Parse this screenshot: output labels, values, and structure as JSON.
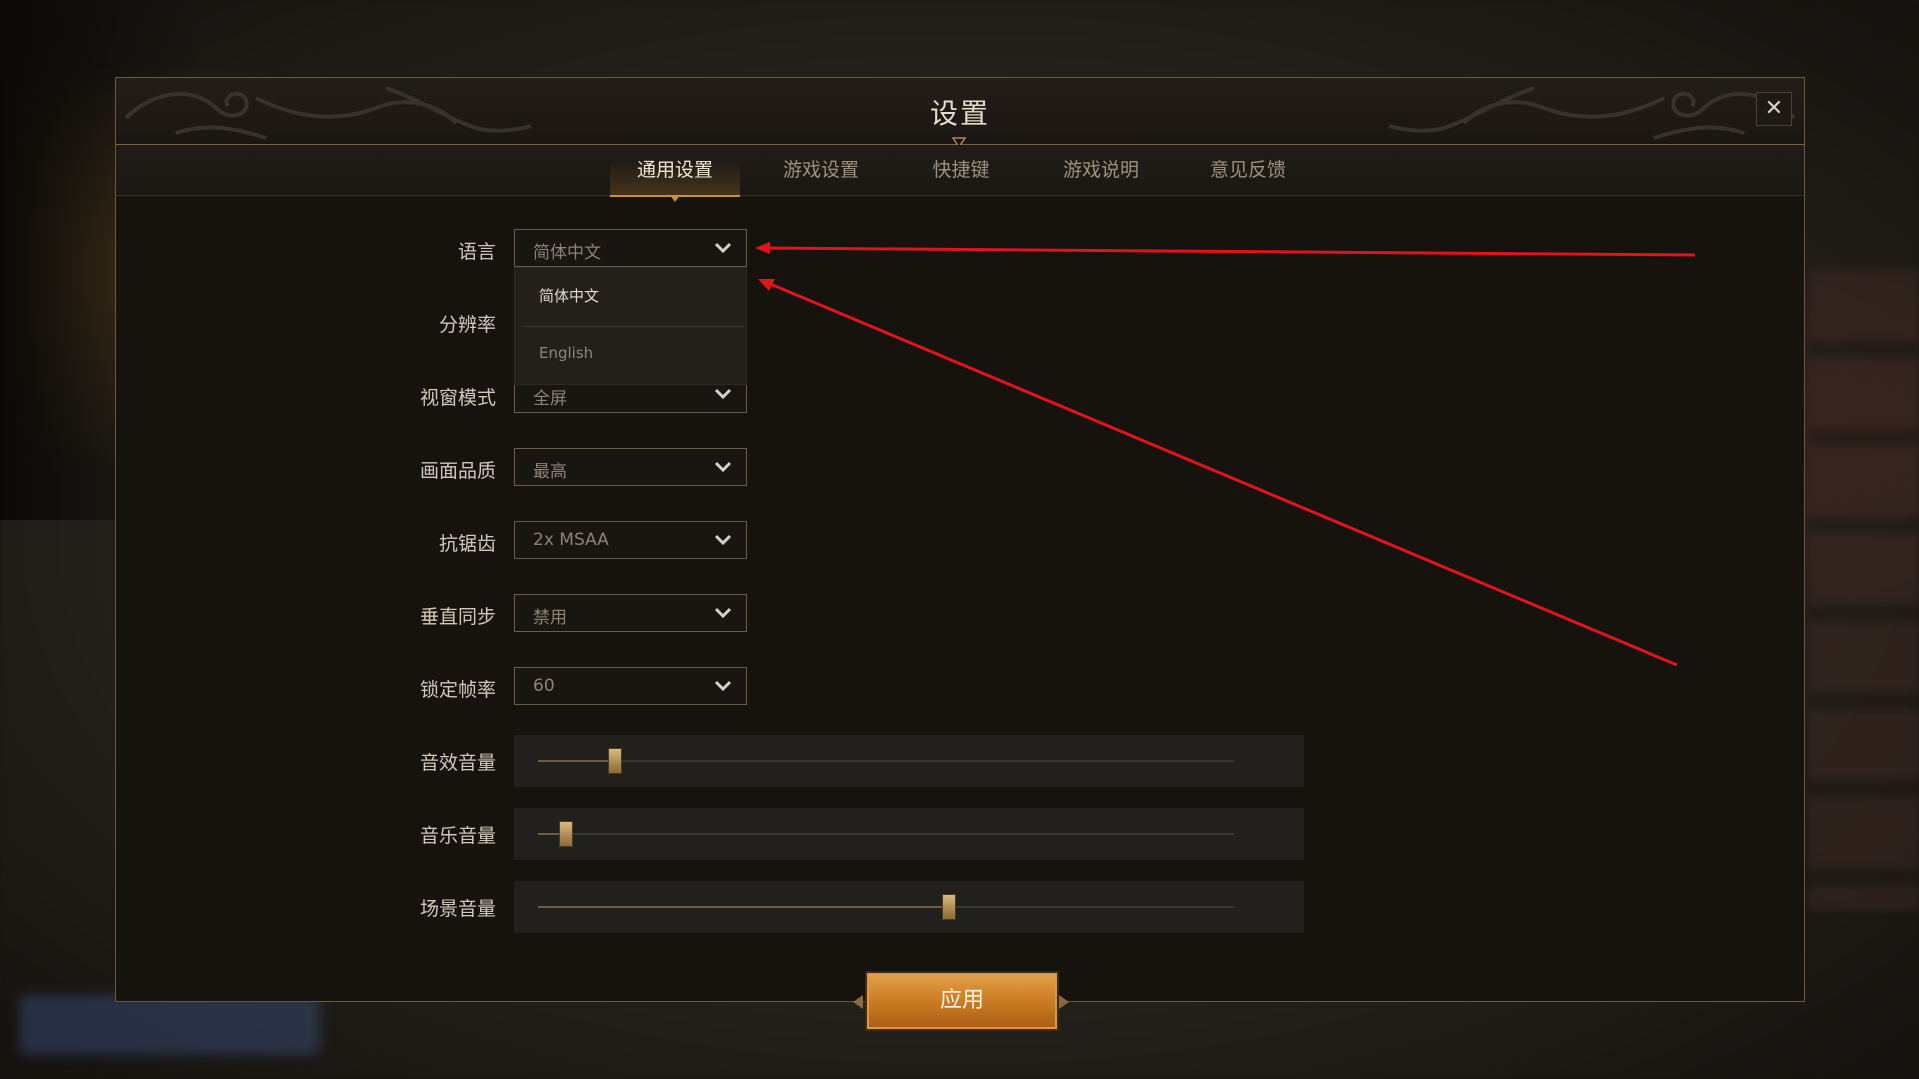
{
  "dialog": {
    "title": "设置",
    "close_glyph": "✕"
  },
  "tabs": [
    {
      "label": "通用设置",
      "active": true
    },
    {
      "label": "游戏设置",
      "active": false
    },
    {
      "label": "快捷键",
      "active": false
    },
    {
      "label": "游戏说明",
      "active": false
    },
    {
      "label": "意见反馈",
      "active": false
    }
  ],
  "settings": {
    "language": {
      "label": "语言",
      "value": "简体中文"
    },
    "resolution": {
      "label": "分辨率"
    },
    "window_mode": {
      "label": "视窗模式",
      "value": "全屏"
    },
    "quality": {
      "label": "画面品质",
      "value": "最高"
    },
    "antialias": {
      "label": "抗锯齿",
      "value": "2x MSAA"
    },
    "vsync": {
      "label": "垂直同步",
      "value": "禁用"
    },
    "fps_lock": {
      "label": "锁定帧率",
      "value": "60"
    }
  },
  "language_dropdown": {
    "options": [
      "简体中文",
      "English"
    ],
    "selected": "简体中文"
  },
  "sliders": [
    {
      "label": "音效音量",
      "value": 0.11
    },
    {
      "label": "音乐音量",
      "value": 0.04
    },
    {
      "label": "场景音量",
      "value": 0.59
    }
  ],
  "apply_button": {
    "label": "应用"
  },
  "colors": {
    "accent_gold": "#c7923f",
    "apply_orange": "#c97920",
    "annotation_red": "#e0141a"
  },
  "icons": [
    "close-icon",
    "chevron-down-icon",
    "ornament"
  ]
}
